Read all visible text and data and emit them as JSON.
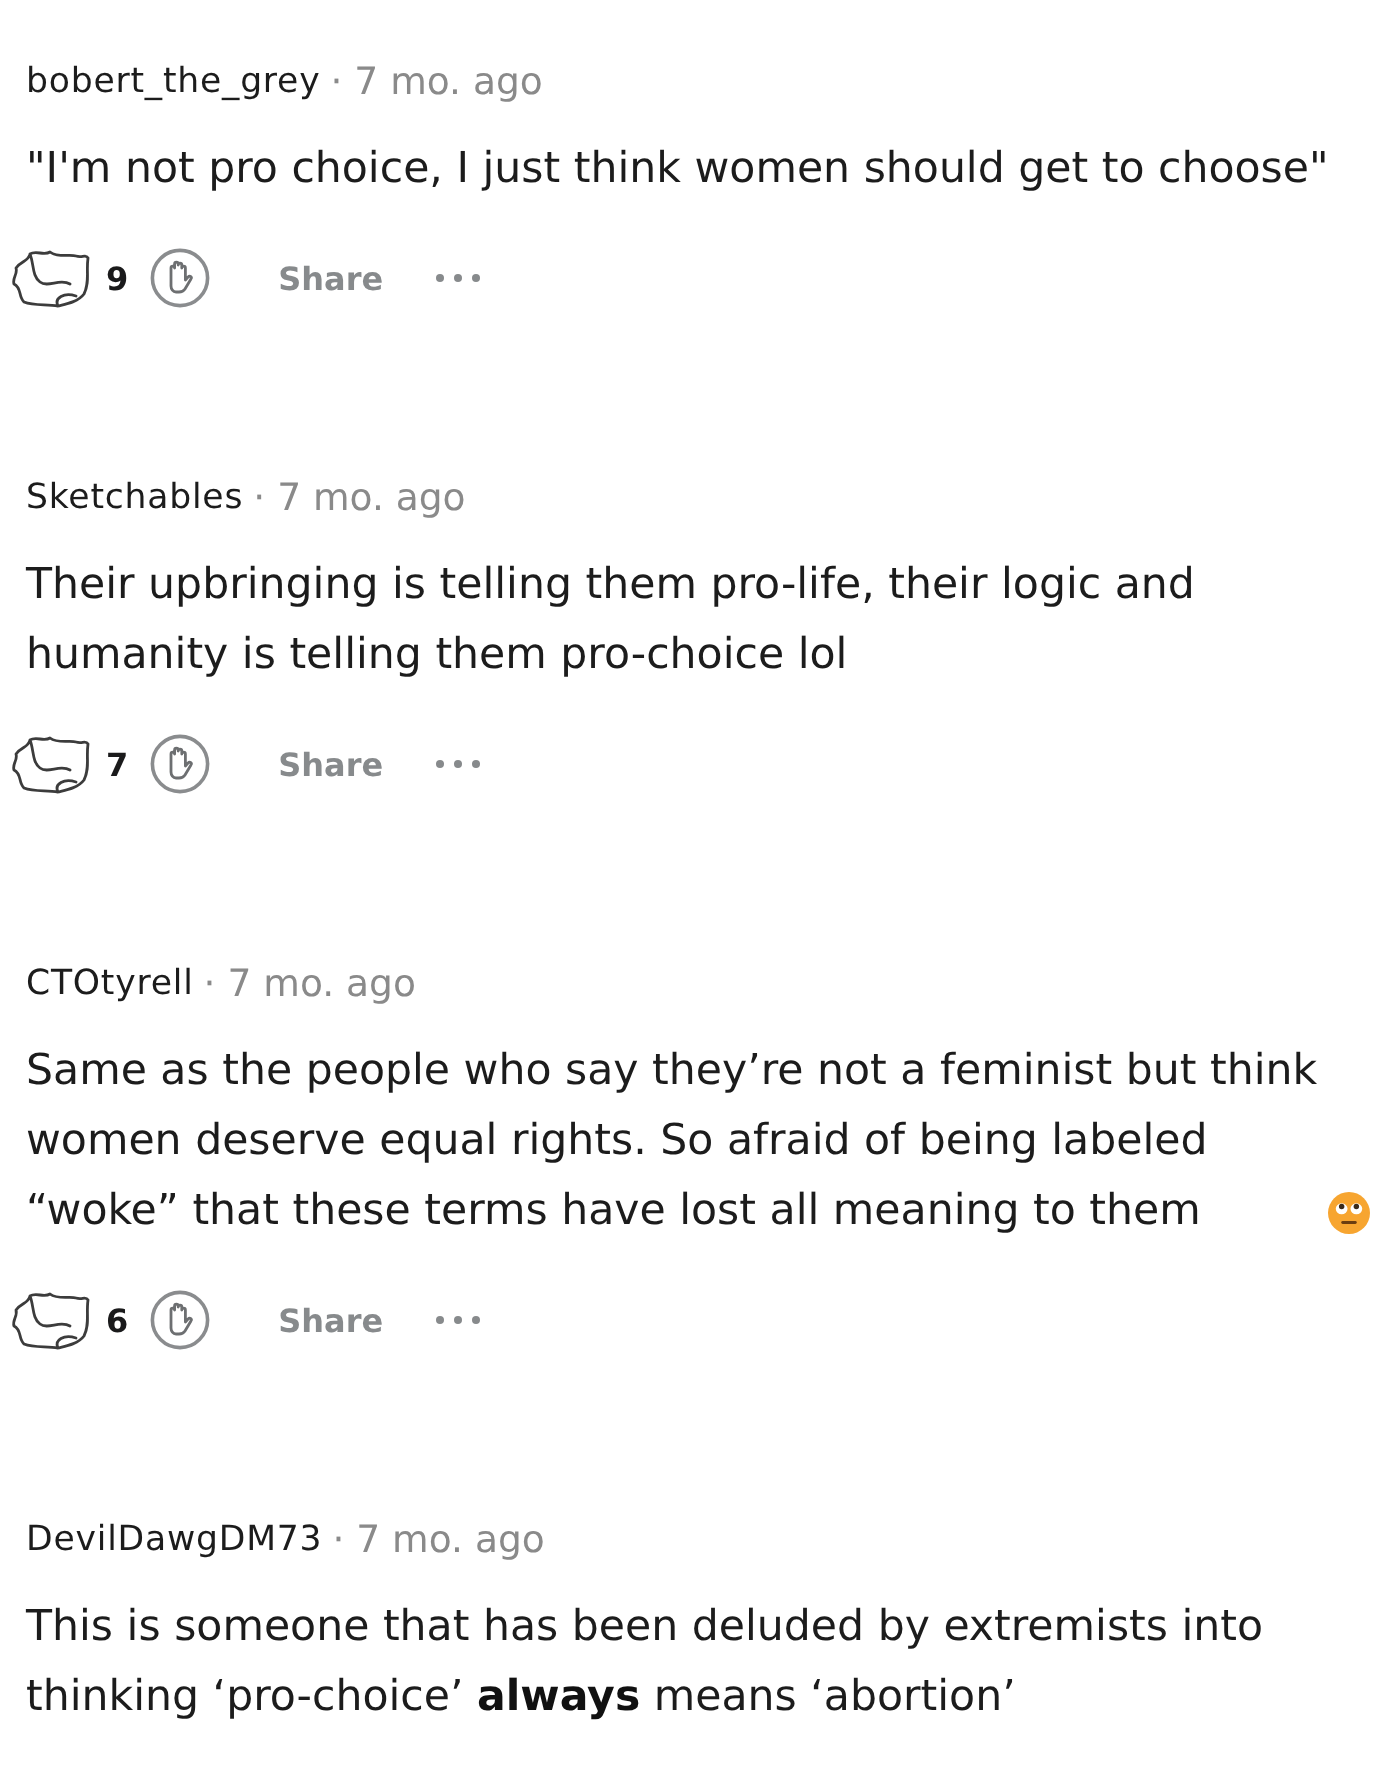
{
  "comments": [
    {
      "username": "bobert_the_grey",
      "time": "· 7 mo. ago",
      "body_lines": [
        "\"I'm not pro choice, I just think women should get to choose\""
      ],
      "score": "9",
      "share_label": "Share"
    },
    {
      "username": "Sketchables",
      "time": "· 7 mo. ago",
      "body_lines": [
        "Their upbringing is telling them pro-life, their logic and",
        "humanity is telling them pro-choice lol"
      ],
      "score": "7",
      "share_label": "Share"
    },
    {
      "username": "CTOtyrell",
      "time": "· 7 mo. ago",
      "body_lines": [
        "Same as the people who say they’re not a feminist but think",
        "women deserve equal rights. So afraid of being labeled",
        "“woke” that these terms have lost all meaning to them"
      ],
      "eye_roll_emoji": true,
      "score": "6",
      "share_label": "Share"
    },
    {
      "username": "DevilDawgDM73",
      "time": "· 7 mo. ago",
      "body_lines": [
        "This is someone that has been deluded by extremists into",
        "thinking ‘pro-choice’ **always** means ‘abortion’"
      ]
    }
  ]
}
